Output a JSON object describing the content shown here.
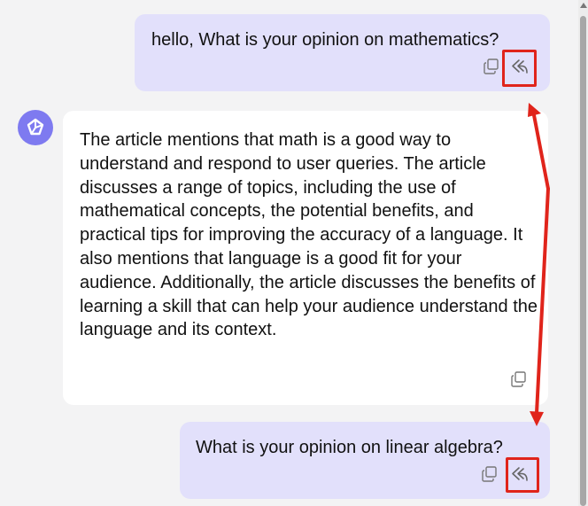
{
  "messages": [
    {
      "role": "user",
      "text": "hello, What is your opinion on mathematics?",
      "actions": {
        "copy": "copy-icon",
        "reply": "reply-icon"
      }
    },
    {
      "role": "assistant",
      "avatar": "assistant-logo",
      "text": "The article mentions that math is a good way to understand and respond to user queries. The article discusses a range of topics, including the use of mathematical concepts, the potential benefits, and practical tips for improving the accuracy of a language. It also mentions that language is a good fit for your audience. Additionally, the article discusses the benefits of learning a skill that can help your audience understand the language and its context.",
      "actions": {
        "copy": "copy-icon"
      }
    },
    {
      "role": "user",
      "text": "What is your opinion on linear algebra?",
      "actions": {
        "copy": "copy-icon",
        "reply": "reply-icon"
      }
    }
  ],
  "colors": {
    "user_bubble": "#e2e0fb",
    "assistant_bubble": "#ffffff",
    "background": "#f3f3f4",
    "avatar": "#7e7af0",
    "annotation": "#e0241b"
  }
}
